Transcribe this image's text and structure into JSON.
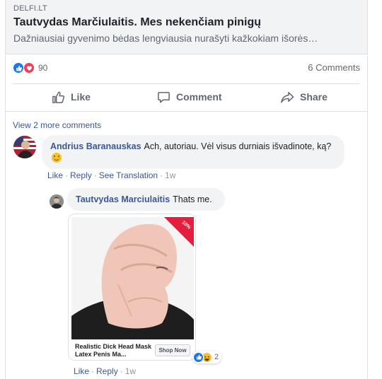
{
  "link": {
    "domain": "DELFI.LT",
    "title": "Tautvydas Marčiulaitis. Mes nekenčiam pinigų",
    "description": "Dažniausiai gyvenimo bėdas lengviausia nurašyti kažkokiam išorės…"
  },
  "stats": {
    "reaction_count": "90",
    "reaction_icons": [
      "like-icon",
      "love-icon"
    ],
    "comments": "6 Comments"
  },
  "actions": {
    "like": "Like",
    "comment": "Comment",
    "share": "Share"
  },
  "comments": {
    "view_more": "View 2 more comments",
    "items": [
      {
        "author": "Andrius Baranauskas",
        "text": "Ach, autoriau. Vėl visus durniais išvadinote, ką?",
        "like": "Like",
        "reply": "Reply",
        "see_translation": "See Translation",
        "time": "1w"
      }
    ],
    "reply": {
      "author": "Tautvydas Marciulaitis",
      "text": "Thats me.",
      "product": {
        "name": "Realistic Dick Head Mask Latex Penis Ma...",
        "button": "Shop Now",
        "badge": "10%"
      },
      "reaction_count": "2",
      "reaction_icons": [
        "like-icon",
        "haha-icon"
      ],
      "like": "Like",
      "reply": "Reply",
      "time": "1w"
    }
  },
  "colors": {
    "link_blue": "#385898",
    "fb_blue": "#1877f2",
    "love_red": "#f33e58",
    "badge_red": "#e41e3f"
  }
}
